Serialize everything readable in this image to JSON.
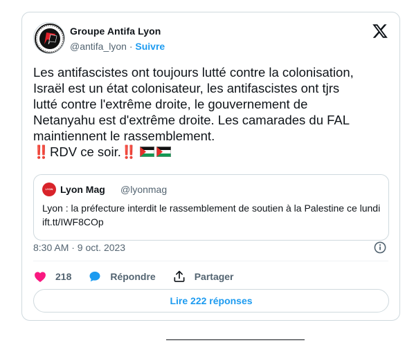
{
  "tweet": {
    "author": {
      "name": "Groupe Antifa Lyon",
      "handle": "@antifa_lyon",
      "separator": "·",
      "follow_label": "Suivre"
    },
    "body": {
      "lines": [
        "Les antifascistes ont toujours lutté contre la colonisation,",
        "Israël est un état colonisateur, les antifascistes ont tjrs",
        "lutté contre l'extrême droite, le gouvernement de",
        "Netanyahu est d'extrême droite. Les camarades du FAL",
        "maintiennent le rassemblement."
      ],
      "emoji_line": {
        "prefix": "‼️",
        "text": "RDV ce soir.",
        "suffix": "‼️",
        "flags": [
          "palestine-flag",
          "palestine-flag"
        ]
      }
    },
    "quote": {
      "author_name": "Lyon Mag",
      "handle": "@lyonmag",
      "avatar_text": "LYON MAG",
      "text": "Lyon : la préfecture interdit le rassemblement de soutien à la Palestine ce lundi ift.tt/IWF8COp"
    },
    "timestamp": "8:30 AM · 9 oct. 2023",
    "actions": {
      "like_count": "218",
      "reply_label": "Répondre",
      "share_label": "Partager"
    },
    "read_replies_label": "Lire 222 réponses"
  },
  "colors": {
    "accent": "#1d9bf0",
    "like": "#f91880",
    "muted": "#536471",
    "border": "#cfd9de",
    "text": "#0f1419"
  },
  "icons": [
    "x-logo-icon",
    "info-icon",
    "heart-icon",
    "reply-bubble-icon",
    "share-icon",
    "palestine-flag-icon"
  ]
}
